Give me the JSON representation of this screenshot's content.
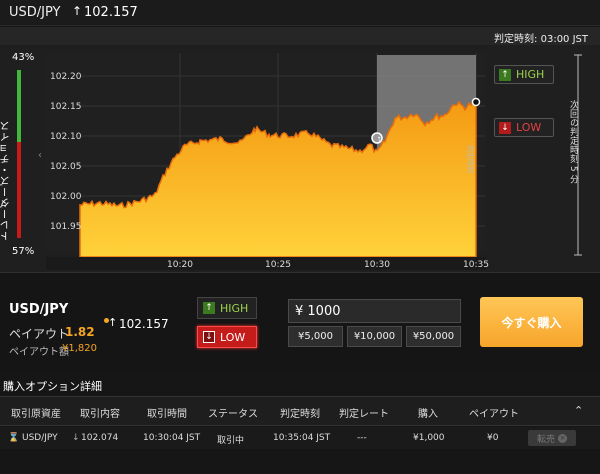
{
  "header": {
    "pair": "USD/JPY",
    "direction_icon": "arrow-up-icon",
    "rate": "102.157",
    "expiry_label": "判定時刻: 03:00 JST"
  },
  "traders_choice": {
    "label": "トレーダーズ・チョイス",
    "high_pct": "43%",
    "low_pct": "57%",
    "high_fraction": 0.43,
    "colors": {
      "high": "#42b83b",
      "low": "#c71b1b"
    }
  },
  "chart": {
    "y_ticks": [
      "102.20",
      "102.15",
      "102.10",
      "102.05",
      "102.00",
      "101.95"
    ],
    "x_ticks": [
      "10:20",
      "10:25",
      "10:30",
      "10:35"
    ],
    "entry_marker_label": "判定時刻",
    "next_expiry_label": "次回の判定時刻 5 分",
    "high_button": "HIGH",
    "low_button": "LOW",
    "fill_color": "#f7a21c"
  },
  "trade": {
    "pair": "USD/JPY",
    "payout_label": "ペイアウト",
    "payout_value": "1.82",
    "rate": "102.157",
    "payout_amount_label": "ペイアウト額",
    "payout_amount": "¥1,820",
    "high_label": "HIGH",
    "low_label": "LOW",
    "amount": "¥ 1000",
    "presets": [
      "¥5,000",
      "¥10,000",
      "¥50,000"
    ],
    "buy_now": "今すぐ購入"
  },
  "options": {
    "title": "購入オプション詳細",
    "columns": [
      "取引原資産",
      "取引内容",
      "取引時間",
      "ステータス",
      "判定時刻",
      "判定レート",
      "購入",
      "ペイアウト"
    ],
    "rows": [
      {
        "asset": "USD/JPY",
        "content": "102.074",
        "trade_time": "10:30:04 JST",
        "status": "取引中",
        "expiry": "10:35:04 JST",
        "expiry_rate": "---",
        "purchase": "¥1,000",
        "payout": "¥0",
        "action": "転売"
      }
    ]
  }
}
